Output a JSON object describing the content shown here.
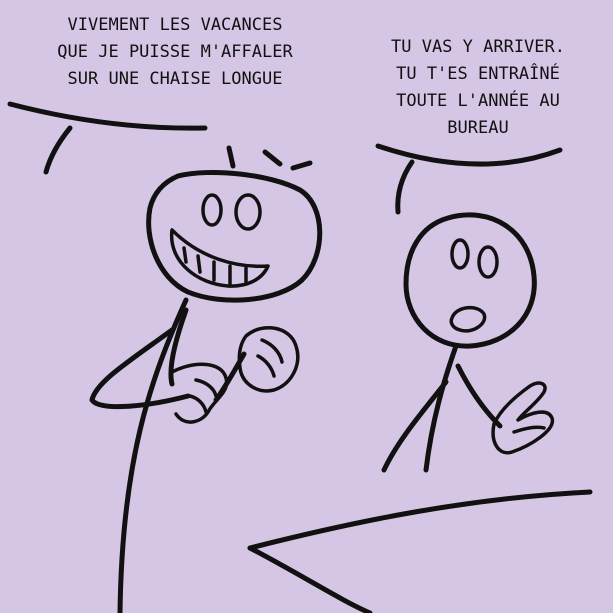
{
  "panel": {
    "background_color": "#d6c6e5",
    "ink_color": "#111111"
  },
  "left_bubble": {
    "lines": [
      "VIVEMENT LES VACANCES",
      "QUE JE PUISSE M'AFFALER",
      "SUR UNE CHAISE LONGUE"
    ]
  },
  "right_bubble": {
    "lines": [
      "TU VAS Y ARRIVER.",
      "TU T'ES ENTRAÎNÉ",
      "TOUTE L'ANNÉE AU",
      "BUREAU"
    ]
  }
}
